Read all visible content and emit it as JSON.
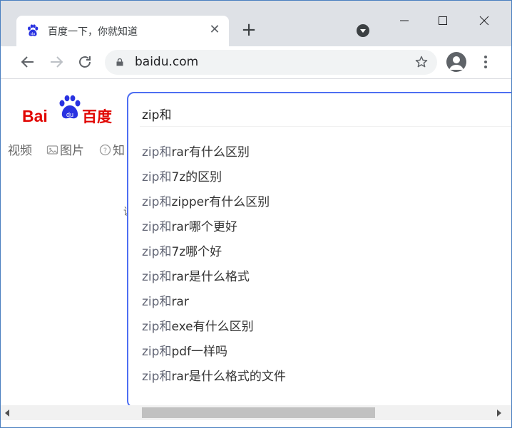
{
  "tab": {
    "title": "百度一下，你就知道",
    "close": "✕"
  },
  "newtab": "+",
  "address": {
    "url": "baidu.com"
  },
  "nav": {
    "video": "视频",
    "images": "图片",
    "zhidao": "知"
  },
  "search": {
    "query": "zip和",
    "suggestions": [
      {
        "q": "zip和",
        "rest": "rar有什么区别"
      },
      {
        "q": "zip和",
        "rest": "7z的区别"
      },
      {
        "q": "zip和",
        "rest": "zipper有什么区别"
      },
      {
        "q": "zip和",
        "rest": "rar哪个更好"
      },
      {
        "q": "zip和",
        "rest": "7z哪个好"
      },
      {
        "q": "zip和",
        "rest": "rar是什么格式"
      },
      {
        "q": "zip和",
        "rest": "rar"
      },
      {
        "q": "zip和",
        "rest": "exe有什么区别"
      },
      {
        "q": "zip和",
        "rest": "pdf一样吗"
      },
      {
        "q": "zip和",
        "rest": "rar是什么格式的文件"
      }
    ]
  },
  "stray_char": "说",
  "colors": {
    "baidu_red": "#e10602",
    "baidu_blue": "#2932e1",
    "search_border": "#4e6ef2"
  }
}
